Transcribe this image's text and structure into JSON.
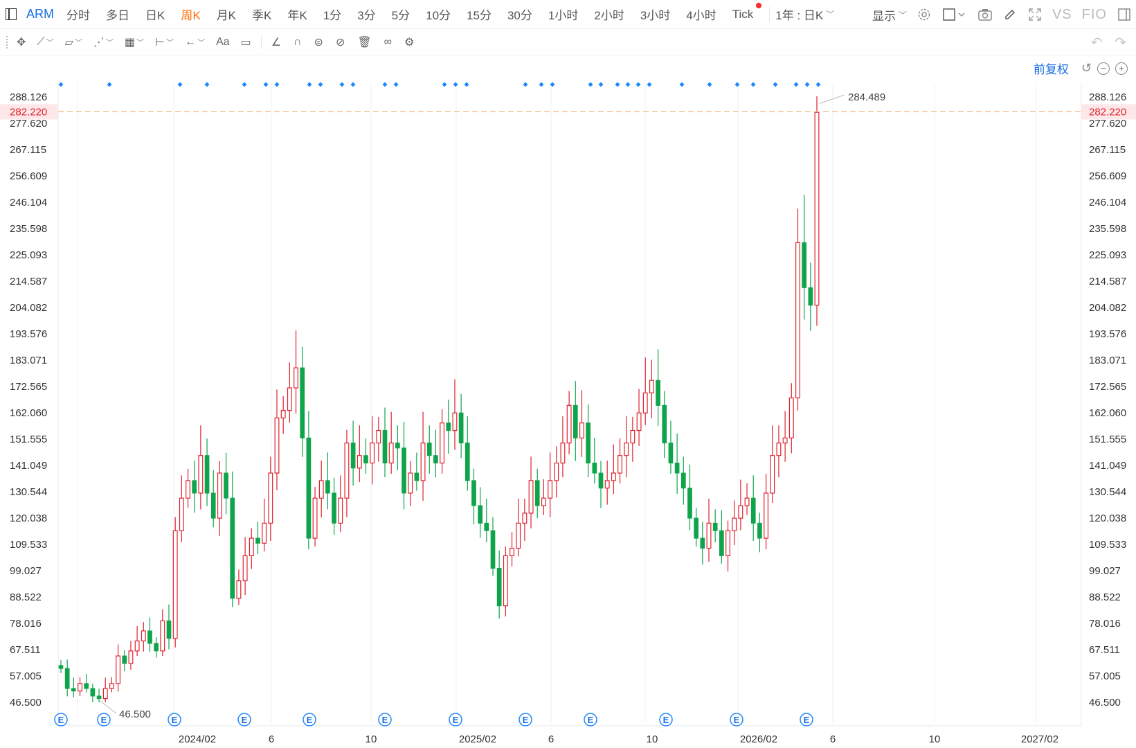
{
  "toolbar": {
    "symbol": "ARM",
    "periods": [
      {
        "label": "分时",
        "name": "period-intraday"
      },
      {
        "label": "多日",
        "name": "period-multiday"
      },
      {
        "label": "日K",
        "name": "period-daily"
      },
      {
        "label": "周K",
        "name": "period-weekly",
        "active": true
      },
      {
        "label": "月K",
        "name": "period-monthly"
      },
      {
        "label": "季K",
        "name": "period-quarterly"
      },
      {
        "label": "年K",
        "name": "period-yearly"
      },
      {
        "label": "1分",
        "name": "period-1m"
      },
      {
        "label": "3分",
        "name": "period-3m"
      },
      {
        "label": "5分",
        "name": "period-5m"
      },
      {
        "label": "10分",
        "name": "period-10m"
      },
      {
        "label": "15分",
        "name": "period-15m"
      },
      {
        "label": "30分",
        "name": "period-30m"
      },
      {
        "label": "1小时",
        "name": "period-1h"
      },
      {
        "label": "2小时",
        "name": "period-2h"
      },
      {
        "label": "3小时",
        "name": "period-3h"
      },
      {
        "label": "4小时",
        "name": "period-4h"
      },
      {
        "label": "Tick",
        "name": "period-tick",
        "dot": true
      }
    ],
    "range_label": "1年 : 日K",
    "display_label": "显示",
    "vs_label": "VS",
    "fio_label": "FIO",
    "accent_color": "#1a6fe0",
    "active_color": "#ff6a00"
  },
  "drawing_tools": [
    {
      "name": "crosshair-tool",
      "icon": "move-icon",
      "glyph": "✥",
      "chevron": false
    },
    {
      "name": "line-tool",
      "icon": "trendline-icon",
      "glyph": "⟋",
      "chevron": true
    },
    {
      "name": "shape-tool",
      "icon": "polygon-icon",
      "glyph": "▱",
      "chevron": true
    },
    {
      "name": "pattern-tool",
      "icon": "pattern-icon",
      "glyph": "⋰",
      "chevron": true
    },
    {
      "name": "fib-tool",
      "icon": "fib-icon",
      "glyph": "▦",
      "chevron": true
    },
    {
      "name": "measure-tool",
      "icon": "measure-icon",
      "glyph": "⊢",
      "chevron": true
    },
    {
      "name": "arrow-tool",
      "icon": "arrow-left-icon",
      "glyph": "←",
      "chevron": true
    },
    {
      "name": "text-tool",
      "icon": "text-icon",
      "glyph": "Aa",
      "chevron": false
    },
    {
      "name": "comment-tool",
      "icon": "comment-icon",
      "glyph": "▭",
      "chevron": false
    }
  ],
  "drawing_tools_2": [
    {
      "name": "angle-tool",
      "icon": "angle-icon",
      "glyph": "∠"
    },
    {
      "name": "magnet-tool",
      "icon": "magnet-icon",
      "glyph": "∩"
    },
    {
      "name": "lock-tool",
      "icon": "lock-drawings-icon",
      "glyph": "⊜"
    },
    {
      "name": "hide-tool",
      "icon": "hide-icon",
      "glyph": "⊘"
    },
    {
      "name": "delete-tool",
      "icon": "trash-icon",
      "glyph": "🗑"
    },
    {
      "name": "link-tool",
      "icon": "link-icon",
      "glyph": "∞"
    },
    {
      "name": "settings-tool",
      "icon": "gear-icon",
      "glyph": "⚙"
    }
  ],
  "adjust_label": "前复权",
  "chart_data": {
    "type": "candlestick",
    "symbol": "ARM",
    "y_ticks": [
      46.5,
      57.005,
      67.511,
      78.016,
      88.522,
      99.027,
      109.533,
      120.038,
      130.544,
      141.049,
      151.555,
      162.06,
      172.565,
      183.071,
      193.576,
      204.082,
      214.587,
      225.093,
      235.598,
      246.104,
      256.609,
      267.115,
      277.62,
      288.126
    ],
    "y_tick_labels": [
      "46.500",
      "57.005",
      "67.511",
      "78.016",
      "88.522",
      "99.027",
      "109.533",
      "120.038",
      "130.544",
      "141.049",
      "151.555",
      "162.060",
      "172.565",
      "183.071",
      "193.576",
      "204.082",
      "214.587",
      "225.093",
      "235.598",
      "246.104",
      "256.609",
      "267.115",
      "277.620",
      "288.126"
    ],
    "current_price": 282.22,
    "current_price_label": "282.220",
    "max_label": "284.489",
    "min_label": "46.500",
    "x_ticks": [
      "2024/02",
      "6",
      "10",
      "2025/02",
      "6",
      "10",
      "2026/02",
      "6",
      "10",
      "2027/02"
    ],
    "up_color": "#e0212d",
    "down_color": "#0ea44b",
    "grid": true,
    "closes": [
      60,
      52,
      51,
      54,
      52,
      49,
      48,
      52,
      54,
      65,
      62,
      67,
      71,
      75,
      70,
      67,
      79,
      72,
      115,
      128,
      135,
      130,
      145,
      130,
      120,
      138,
      128,
      88,
      95,
      105,
      112,
      110,
      118,
      138,
      160,
      163,
      172,
      180,
      152,
      112,
      128,
      135,
      130,
      118,
      128,
      150,
      140,
      145,
      142,
      150,
      155,
      142,
      150,
      148,
      130,
      138,
      135,
      150,
      145,
      142,
      158,
      155,
      162,
      150,
      135,
      125,
      118,
      115,
      100,
      85,
      105,
      108,
      118,
      122,
      135,
      125,
      128,
      135,
      142,
      150,
      165,
      152,
      158,
      142,
      138,
      132,
      135,
      138,
      145,
      150,
      155,
      162,
      170,
      175,
      165,
      150,
      142,
      138,
      132,
      120,
      112,
      108,
      118,
      115,
      105,
      115,
      120,
      125,
      128,
      118,
      112,
      130,
      145,
      150,
      152,
      168,
      230,
      212,
      205,
      282
    ]
  }
}
